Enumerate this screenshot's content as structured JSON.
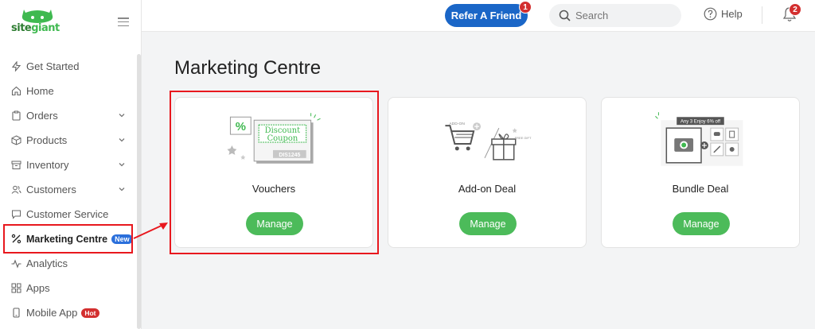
{
  "brand": {
    "logo_text_a": "site",
    "logo_text_b": "giant",
    "accent": "#3fb950"
  },
  "sidebar": {
    "items": [
      {
        "label": "Get Started",
        "icon": "bolt-icon"
      },
      {
        "label": "Home",
        "icon": "home-icon"
      },
      {
        "label": "Orders",
        "icon": "clipboard-icon",
        "expandable": true
      },
      {
        "label": "Products",
        "icon": "box-icon",
        "expandable": true
      },
      {
        "label": "Inventory",
        "icon": "archive-icon",
        "expandable": true
      },
      {
        "label": "Customers",
        "icon": "users-icon",
        "expandable": true
      },
      {
        "label": "Customer Service",
        "icon": "chat-icon"
      },
      {
        "label": "Marketing Centre",
        "icon": "percent-icon",
        "badge": "New",
        "active": true
      },
      {
        "label": "Analytics",
        "icon": "pulse-icon"
      },
      {
        "label": "Apps",
        "icon": "grid-icon"
      },
      {
        "label": "Mobile App",
        "icon": "phone-icon",
        "badge": "Hot"
      }
    ]
  },
  "topbar": {
    "refer_label": "Refer A Friend",
    "refer_badge": "1",
    "search_placeholder": "Search",
    "help_label": "Help",
    "notif_badge": "2"
  },
  "main": {
    "title": "Marketing Centre",
    "cards": [
      {
        "name": "Vouchers",
        "button": "Manage",
        "art": {
          "coupon_line1": "Discount",
          "coupon_line2": "Coupon",
          "code": "DIS1245",
          "percent": "%"
        }
      },
      {
        "name": "Add-on Deal",
        "button": "Manage",
        "art": {
          "tag1": "ADD-ON",
          "tag2": "FREE GIFT"
        }
      },
      {
        "name": "Bundle Deal",
        "button": "Manage",
        "art": {
          "banner": "Any 3 Enjoy 6% off"
        }
      }
    ]
  },
  "colors": {
    "primary_blue": "#1a66c7",
    "manage_green": "#4cbb5a",
    "highlight_red": "#e8181e",
    "badge_red": "#d32f2f"
  }
}
